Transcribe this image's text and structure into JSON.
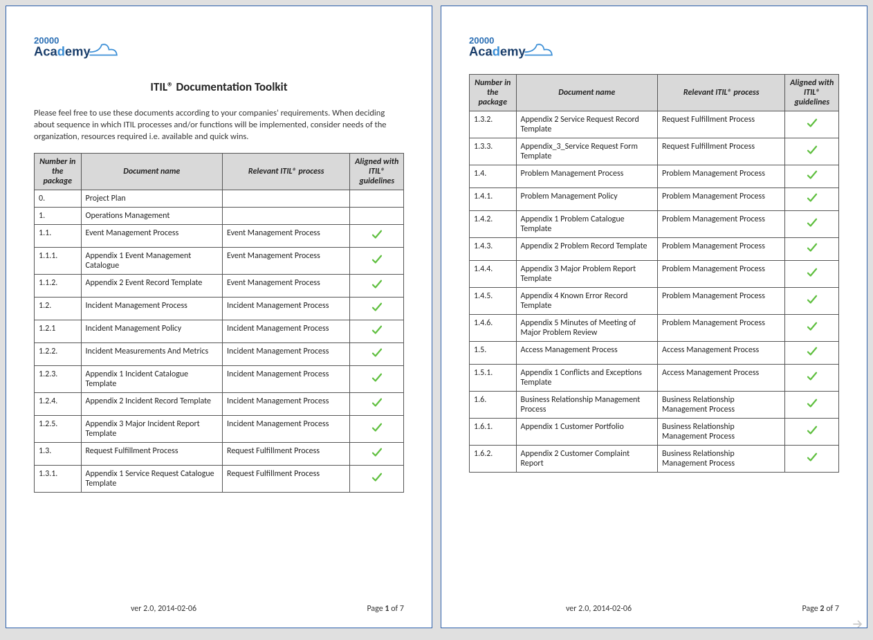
{
  "logo_text_top": "20000",
  "logo_text_bottom": "Academy",
  "title": "ITIL® Documentation Toolkit",
  "intro": "Please feel free to use these documents according to your companies' requirements. When deciding about sequence in which ITIL processes and/or functions will be implemented, consider needs of the organization, resources required i.e. available and quick wins.",
  "headers": {
    "num": "Number in the package",
    "doc": "Document name",
    "proc": "Relevant ITIL® process",
    "align": "Aligned with ITIL® guidelines"
  },
  "page1_rows": [
    {
      "num": "0.",
      "doc": "Project Plan",
      "proc": "",
      "check": false
    },
    {
      "num": "1.",
      "doc": "Operations Management",
      "proc": "",
      "check": false
    },
    {
      "num": "1.1.",
      "doc": "Event Management Process",
      "proc": "Event Management Process",
      "check": true
    },
    {
      "num": "1.1.1.",
      "doc": "Appendix 1 Event Management Catalogue",
      "proc": "Event Management Process",
      "check": true
    },
    {
      "num": "1.1.2.",
      "doc": "Appendix 2 Event Record Template",
      "proc": "Event Management Process",
      "check": true
    },
    {
      "num": "1.2.",
      "doc": "Incident Management Process",
      "proc": "Incident Management Process",
      "check": true
    },
    {
      "num": "1.2.1",
      "doc": "Incident Management Policy",
      "proc": "Incident Management Process",
      "check": true
    },
    {
      "num": "1.2.2.",
      "doc": "Incident Measurements And Metrics",
      "proc": "Incident Management Process",
      "check": true
    },
    {
      "num": "1.2.3.",
      "doc": "Appendix 1 Incident Catalogue Template",
      "proc": "Incident Management Process",
      "check": true
    },
    {
      "num": "1.2.4.",
      "doc": "Appendix 2 Incident Record Template",
      "proc": "Incident Management Process",
      "check": true
    },
    {
      "num": "1.2.5.",
      "doc": "Appendix 3 Major Incident Report Template",
      "proc": "Incident Management Process",
      "check": true
    },
    {
      "num": "1.3.",
      "doc": "Request Fulfillment Process",
      "proc": "Request Fulfillment Process",
      "check": true
    },
    {
      "num": "1.3.1.",
      "doc": "Appendix 1 Service Request Catalogue Template",
      "proc": "Request Fulfillment Process",
      "check": true
    }
  ],
  "page2_rows": [
    {
      "num": "1.3.2.",
      "doc": "Appendix 2 Service Request Record Template",
      "proc": "Request Fulfillment Process",
      "check": true
    },
    {
      "num": "1.3.3.",
      "doc": "Appendix_3_Service Request Form Template",
      "proc": "Request Fulfillment Process",
      "check": true
    },
    {
      "num": "1.4.",
      "doc": "Problem Management Process",
      "proc": "Problem Management Process",
      "check": true
    },
    {
      "num": "1.4.1.",
      "doc": "Problem Management Policy",
      "proc": "Problem Management Process",
      "check": true
    },
    {
      "num": "1.4.2.",
      "doc": "Appendix 1 Problem Catalogue Template",
      "proc": "Problem Management Process",
      "check": true
    },
    {
      "num": "1.4.3.",
      "doc": "Appendix 2 Problem Record Template",
      "proc": "Problem Management Process",
      "check": true
    },
    {
      "num": "1.4.4.",
      "doc": "Appendix 3 Major Problem Report Template",
      "proc": "Problem Management Process",
      "check": true
    },
    {
      "num": "1.4.5.",
      "doc": "Appendix 4 Known Error Record Template",
      "proc": "Problem Management Process",
      "check": true
    },
    {
      "num": "1.4.6.",
      "doc": "Appendix 5 Minutes of Meeting of Major Problem Review",
      "proc": "Problem Management Process",
      "check": true
    },
    {
      "num": "1.5.",
      "doc": "Access Management Process",
      "proc": "Access Management Process",
      "check": true
    },
    {
      "num": "1.5.1.",
      "doc": "Appendix 1 Conflicts and Exceptions Template",
      "proc": "Access Management Process",
      "check": true
    },
    {
      "num": "1.6.",
      "doc": "Business Relationship Management Process",
      "proc": "Business Relationship Management Process",
      "check": true
    },
    {
      "num": "1.6.1.",
      "doc": "Appendix 1 Customer Portfolio",
      "proc": "Business Relationship Management Process",
      "check": true
    },
    {
      "num": "1.6.2.",
      "doc": "Appendix 2 Customer Complaint Report",
      "proc": "Business Relationship Management Process",
      "check": true
    }
  ],
  "footer": {
    "version": "ver  2.0, 2014-02-06",
    "page1": {
      "prefix": "Page ",
      "num": "1",
      "suffix": " of ",
      "total": "7"
    },
    "page2": {
      "prefix": "Page ",
      "num": "2",
      "suffix": " of ",
      "total": "7"
    }
  }
}
